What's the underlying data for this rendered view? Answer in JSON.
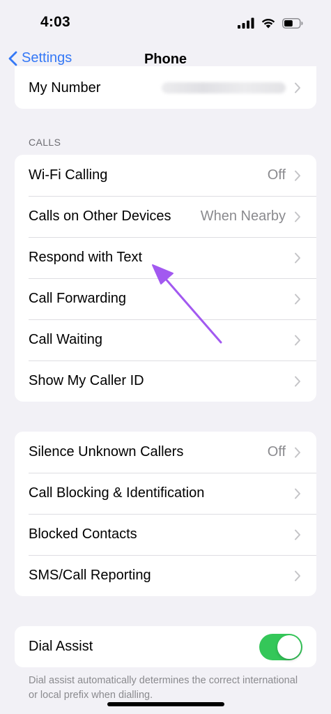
{
  "status_bar": {
    "time": "4:03",
    "battery_level": 0.55
  },
  "nav": {
    "back_label": "Settings",
    "title": "Phone"
  },
  "top_group": {
    "my_number_label": "My Number"
  },
  "calls_section": {
    "header": "CALLS",
    "rows": [
      {
        "label": "Wi-Fi Calling",
        "value": "Off"
      },
      {
        "label": "Calls on Other Devices",
        "value": "When Nearby"
      },
      {
        "label": "Respond with Text",
        "value": ""
      },
      {
        "label": "Call Forwarding",
        "value": ""
      },
      {
        "label": "Call Waiting",
        "value": ""
      },
      {
        "label": "Show My Caller ID",
        "value": ""
      }
    ]
  },
  "blocking_section": {
    "rows": [
      {
        "label": "Silence Unknown Callers",
        "value": "Off"
      },
      {
        "label": "Call Blocking & Identification",
        "value": ""
      },
      {
        "label": "Blocked Contacts",
        "value": ""
      },
      {
        "label": "SMS/Call Reporting",
        "value": ""
      }
    ]
  },
  "dial_assist": {
    "label": "Dial Assist",
    "enabled": true,
    "footer": "Dial assist automatically determines the correct international or local prefix when dialling."
  },
  "colors": {
    "accent": "#3478f6",
    "toggle_on": "#34c759",
    "annotation_arrow": "#a259f0"
  },
  "icons": {
    "signal": "cellular-signal-icon",
    "wifi": "wifi-icon",
    "battery": "battery-icon",
    "back": "chevron-left-icon",
    "row_disclosure": "chevron-right-icon",
    "annotation": "annotation-arrow-icon"
  }
}
